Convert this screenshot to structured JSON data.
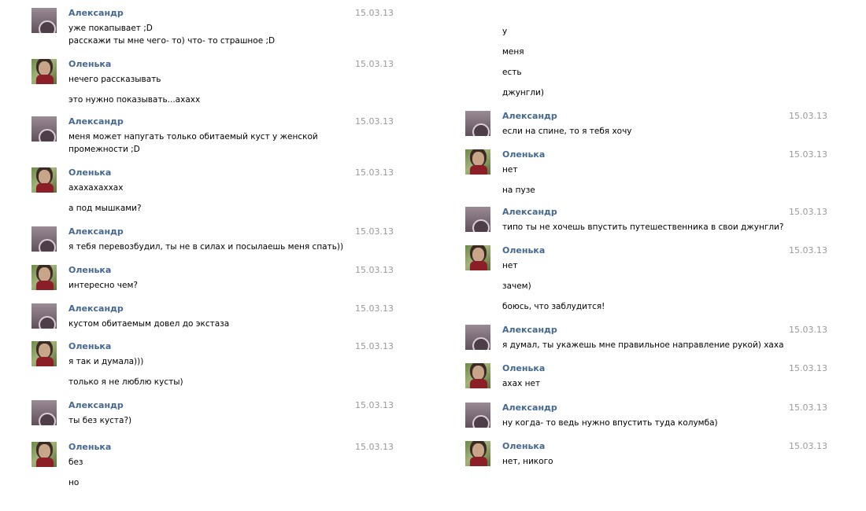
{
  "left_column": [
    {
      "sender": "Александр",
      "avatar": "male-avatar",
      "date": "15.03.13",
      "lines": [
        "уже покапывает ;D",
        "расскажи ты мне чего- то) что- то страшное ;D"
      ]
    },
    {
      "sender": "Оленька",
      "avatar": "female-avatar",
      "date": "15.03.13",
      "lines": [
        "нечего рассказывать",
        "это нужно показывать...ахахх"
      ]
    },
    {
      "sender": "Александр",
      "avatar": "male-avatar",
      "date": "15.03.13",
      "lines": [
        "меня может напугать только обитаемый куст у женской",
        "промежности ;D"
      ]
    },
    {
      "sender": "Оленька",
      "avatar": "female-avatar",
      "date": "15.03.13",
      "lines": [
        "ахахахаххах",
        "а под мышками?"
      ]
    },
    {
      "sender": "Александр",
      "avatar": "male-avatar",
      "date": "15.03.13",
      "lines": [
        "я тебя перевозбудил, ты не в силах и посылаешь меня спать))"
      ]
    },
    {
      "sender": "Оленька",
      "avatar": "female-avatar",
      "date": "15.03.13",
      "lines": [
        "интересно чем?"
      ]
    },
    {
      "sender": "Александр",
      "avatar": "male-avatar",
      "date": "15.03.13",
      "lines": [
        "кустом обитаемым довел до экстаза"
      ]
    },
    {
      "sender": "Оленька",
      "avatar": "female-avatar",
      "date": "15.03.13",
      "lines": [
        "я так и думала)))",
        "только я не люблю кусты)"
      ]
    },
    {
      "sender": "Александр",
      "avatar": "male-avatar",
      "date": "15.03.13",
      "lines": [
        "ты без куста?)"
      ]
    },
    {
      "sender": "Оленька",
      "avatar": "female-avatar",
      "date": "15.03.13",
      "lines": [
        "без",
        "но"
      ]
    }
  ],
  "right_column_continuation": [
    "у",
    "меня",
    "есть",
    "джунгли)"
  ],
  "right_column": [
    {
      "sender": "Александр",
      "avatar": "male-avatar",
      "date": "15.03.13",
      "lines": [
        "если на спине, то я тебя хочу"
      ]
    },
    {
      "sender": "Оленька",
      "avatar": "female-avatar",
      "date": "15.03.13",
      "lines": [
        "нет",
        "на пузе"
      ]
    },
    {
      "sender": "Александр",
      "avatar": "male-avatar",
      "date": "15.03.13",
      "lines": [
        "типо ты не хочешь впустить путешественника в свои джунгли?"
      ]
    },
    {
      "sender": "Оленька",
      "avatar": "female-avatar",
      "date": "15.03.13",
      "lines": [
        "нет",
        "зачем)",
        "боюсь, что заблудится!"
      ]
    },
    {
      "sender": "Александр",
      "avatar": "male-avatar",
      "date": "15.03.13",
      "lines": [
        "я думал, ты укажешь мне правильное направление рукой) хаха"
      ]
    },
    {
      "sender": "Оленька",
      "avatar": "female-avatar",
      "date": "15.03.13",
      "lines": [
        "ахах нет"
      ]
    },
    {
      "sender": "Александр",
      "avatar": "male-avatar",
      "date": "15.03.13",
      "lines": [
        "ну когда- то ведь нужно впустить туда колумба)"
      ]
    },
    {
      "sender": "Оленька",
      "avatar": "female-avatar",
      "date": "15.03.13",
      "lines": [
        "нет, никого"
      ]
    }
  ]
}
